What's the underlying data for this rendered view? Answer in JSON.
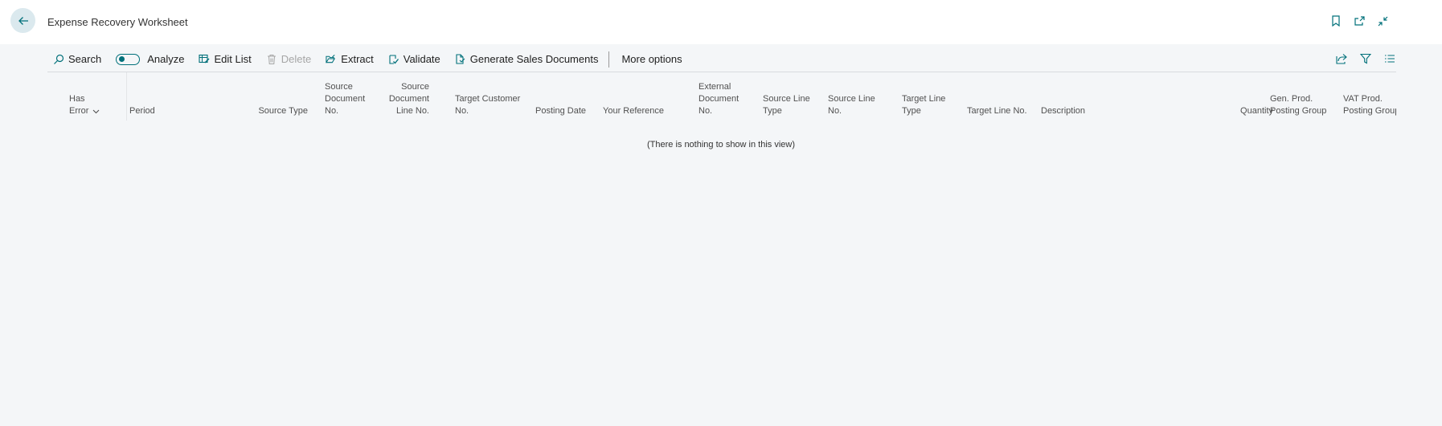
{
  "header": {
    "title": "Expense Recovery Worksheet",
    "icons": [
      "back-arrow-icon",
      "bookmark-icon",
      "open-new-window-icon",
      "collapse-icon"
    ]
  },
  "toolbar": {
    "search": "Search",
    "analyze": "Analyze",
    "edit_list": "Edit List",
    "delete": "Delete",
    "extract": "Extract",
    "validate": "Validate",
    "generate": "Generate Sales Documents",
    "more": "More options",
    "right_icons": [
      "share-icon",
      "filter-icon",
      "list-view-icon"
    ]
  },
  "columns": {
    "has_error": [
      "Has",
      "Error"
    ],
    "period": "Period",
    "source_type": "Source Type",
    "source_doc_no": [
      "Source",
      "Document",
      "No."
    ],
    "source_doc_line_no": [
      "Source",
      "Document",
      "Line No."
    ],
    "target_customer_no": [
      "Target Customer",
      "No."
    ],
    "posting_date": "Posting Date",
    "your_reference": "Your Reference",
    "external_doc_no": [
      "External",
      "Document",
      "No."
    ],
    "source_line_type": [
      "Source Line",
      "Type"
    ],
    "source_line_no": [
      "Source Line",
      "No."
    ],
    "target_line_type": [
      "Target Line",
      "Type"
    ],
    "target_line_no": "Target Line No.",
    "description": "Description",
    "quantity": "Quantity",
    "gen_prod_posting_group": [
      "Gen. Prod.",
      "Posting Group"
    ],
    "vat_prod_posting_group": [
      "VAT Prod.",
      "Posting Group"
    ]
  },
  "empty_message": "(There is nothing to show in this view)",
  "colors": {
    "accent": "#00707a",
    "background": "#f4f6f8"
  }
}
